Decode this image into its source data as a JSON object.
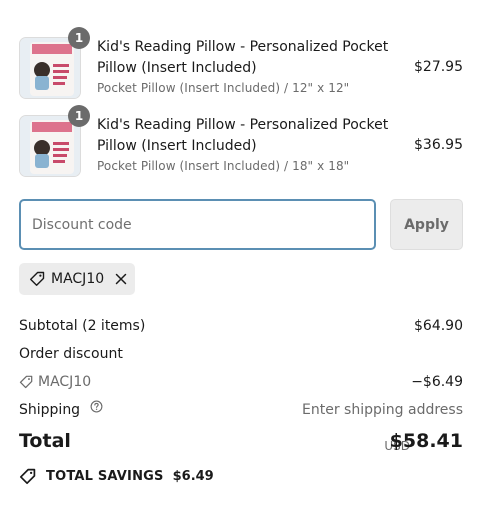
{
  "items": [
    {
      "title": "Kid's Reading Pillow - Personalized Pocket Pillow (Insert Included)",
      "variant": "Pocket Pillow (Insert Included) / 12\" x 12\"",
      "price": "$27.95",
      "quantity": "1"
    },
    {
      "title": "Kid's Reading Pillow - Personalized Pocket Pillow (Insert Included)",
      "variant": "Pocket Pillow (Insert Included) / 18\" x 18\"",
      "price": "$36.95",
      "quantity": "1"
    }
  ],
  "discount": {
    "placeholder": "Discount code",
    "apply_label": "Apply",
    "applied_code": "MACJ10"
  },
  "summary": {
    "subtotal_label": "Subtotal (2 items)",
    "subtotal_value": "$64.90",
    "order_discount_label": "Order discount",
    "discount_code": "MACJ10",
    "discount_value": "−$6.49",
    "shipping_label": "Shipping",
    "shipping_value": "Enter shipping address",
    "total_label": "Total",
    "currency": "USD",
    "total_value": "$58.41",
    "savings_label": "TOTAL SAVINGS",
    "savings_value": "$6.49"
  },
  "colors": {
    "input_focus_border": "#5b8fb3",
    "badge": "#6b6b6b",
    "muted_text": "#6b6b6b",
    "chip_background": "#ececec"
  },
  "icons": {
    "tag": "tag-icon",
    "remove": "close-icon",
    "help": "question-circle-icon",
    "savings": "tag-icon"
  }
}
